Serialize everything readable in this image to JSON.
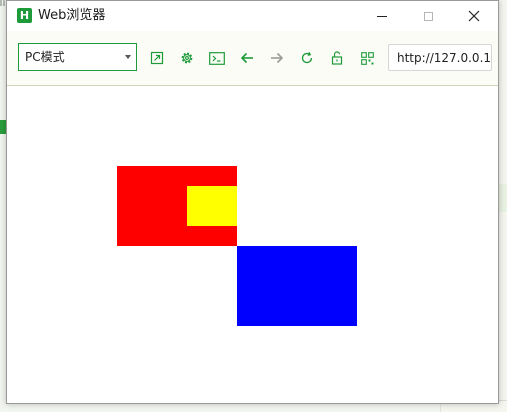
{
  "window": {
    "title": "Web浏览器",
    "logo_letter": "H"
  },
  "toolbar": {
    "mode_select": {
      "value": "PC模式"
    },
    "icons": [
      "open-external-icon",
      "settings-gear-icon",
      "console-icon",
      "back-arrow-icon",
      "forward-arrow-icon",
      "refresh-icon",
      "unlock-icon",
      "qr-code-icon"
    ],
    "url": "http://127.0.0.1:"
  },
  "page": {
    "shapes": [
      {
        "name": "red-rectangle",
        "color": "#ff0000"
      },
      {
        "name": "yellow-rectangle",
        "color": "#ffff00"
      },
      {
        "name": "blue-rectangle",
        "color": "#0000ff"
      }
    ]
  },
  "colors": {
    "accent": "#1d9b3a",
    "toolbar_bg": "#fcfcf6"
  }
}
